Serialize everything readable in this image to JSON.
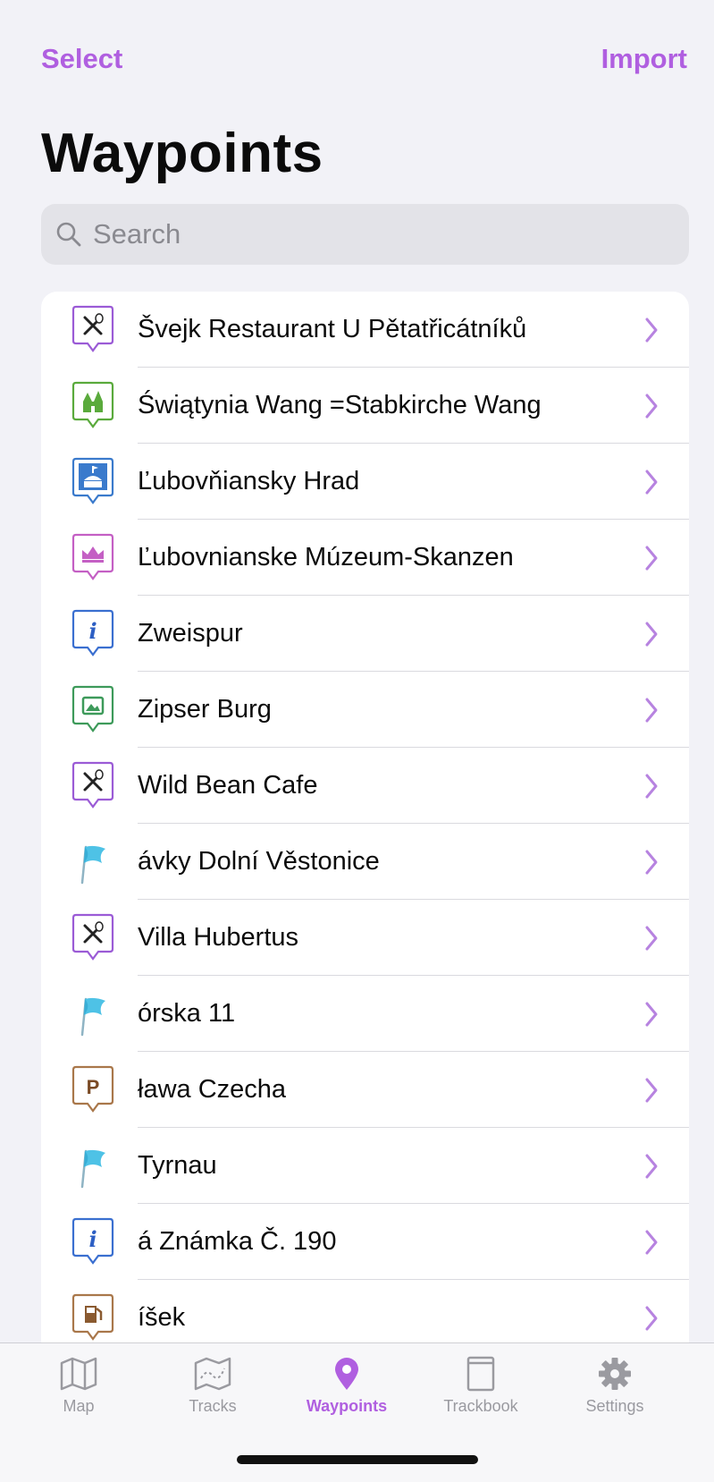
{
  "header": {
    "select_label": "Select",
    "import_label": "Import",
    "title": "Waypoints"
  },
  "search": {
    "placeholder": "Search"
  },
  "waypoints": [
    {
      "name": "Švejk Restaurant U Pětatřicátníků",
      "icon": "restaurant-icon"
    },
    {
      "name": "Świątynia Wang =Stabkirche Wang",
      "icon": "church-icon"
    },
    {
      "name": "Ľubovňiansky Hrad",
      "icon": "castle-icon"
    },
    {
      "name": "Ľubovnianske Múzeum-Skanzen",
      "icon": "museum-crown-icon"
    },
    {
      "name": "Zweispur",
      "icon": "info-icon"
    },
    {
      "name": "Zipser Burg",
      "icon": "viewpoint-icon"
    },
    {
      "name": "Wild Bean Cafe",
      "icon": "restaurant-icon"
    },
    {
      "name": "ávky Dolní Věstonice",
      "icon": "flag-icon"
    },
    {
      "name": "Villa Hubertus",
      "icon": "restaurant-icon"
    },
    {
      "name": "órska 11",
      "icon": "flag-icon"
    },
    {
      "name": "ława Czecha",
      "icon": "parking-icon"
    },
    {
      "name": "Tyrnau",
      "icon": "flag-icon"
    },
    {
      "name": "á Známka Č. 190",
      "icon": "info-icon"
    },
    {
      "name": "íšek",
      "icon": "fuel-icon"
    }
  ],
  "tabs": [
    {
      "label": "Map",
      "icon": "map-icon",
      "active": false
    },
    {
      "label": "Tracks",
      "icon": "tracks-icon",
      "active": false
    },
    {
      "label": "Waypoints",
      "icon": "waypoint-pin-icon",
      "active": true
    },
    {
      "label": "Trackbook",
      "icon": "trackbook-icon",
      "active": false
    },
    {
      "label": "Settings",
      "icon": "gear-icon",
      "active": false
    }
  ],
  "colors": {
    "accent": "#b05fe0",
    "background": "#f2f2f7",
    "tab_inactive": "#9a9aa0"
  }
}
